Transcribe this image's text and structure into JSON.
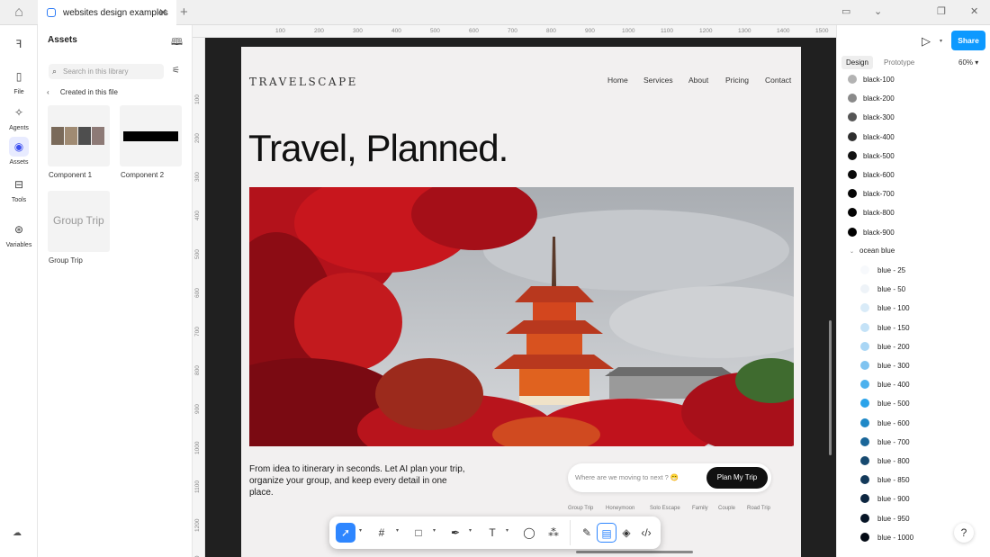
{
  "titlebar": {
    "tab_title": "websites design examples",
    "new_tab": "+"
  },
  "rail": {
    "items": [
      {
        "label": "File",
        "icon": "file-icon"
      },
      {
        "label": "Agents",
        "icon": "agents-icon"
      },
      {
        "label": "Assets",
        "icon": "assets-icon"
      },
      {
        "label": "Tools",
        "icon": "tools-icon"
      },
      {
        "label": "Variables",
        "icon": "variables-icon"
      }
    ]
  },
  "assets": {
    "title": "Assets",
    "search_placeholder": "Search in this library",
    "section": "Created in this file",
    "components": [
      {
        "label": "Component 1"
      },
      {
        "label": "Component 2"
      },
      {
        "label": "Group Trip",
        "preview": "Group Trip"
      }
    ]
  },
  "rulers": {
    "top": [
      "100",
      "200",
      "300",
      "400",
      "500",
      "600",
      "700",
      "800",
      "900",
      "1000",
      "1100",
      "1200",
      "1300",
      "1400",
      "1500"
    ],
    "left": [
      "100",
      "200",
      "300",
      "400",
      "500",
      "600",
      "700",
      "800",
      "900",
      "1000",
      "1100",
      "1200",
      "1300"
    ]
  },
  "site": {
    "logo": "TRAVELSCAPE",
    "nav": [
      "Home",
      "Services",
      "About",
      "Pricing",
      "Contact"
    ],
    "hero_title": "Travel, Planned.",
    "tagline": "From idea to itinerary in seconds. Let AI plan your trip, organize your group, and keep every detail in one place.",
    "input_placeholder": "Where are we moving to next ? 😁",
    "cta": "Plan My Trip",
    "chips": [
      "Group Trip",
      "Honeymoon",
      "Solo Escape",
      "Family",
      "Couple",
      "Road Trip"
    ]
  },
  "right": {
    "share": "Share",
    "tabs": [
      "Design",
      "Prototype"
    ],
    "zoom": "60%",
    "black_swatches": [
      {
        "name": "black-100",
        "color": "#b3b3b3"
      },
      {
        "name": "black-200",
        "color": "#8a8a8a"
      },
      {
        "name": "black-300",
        "color": "#555555"
      },
      {
        "name": "black-400",
        "color": "#2e2e2e"
      },
      {
        "name": "black-500",
        "color": "#111111"
      },
      {
        "name": "black-600",
        "color": "#0a0a0a"
      },
      {
        "name": "black-700",
        "color": "#060606"
      },
      {
        "name": "black-800",
        "color": "#030303"
      },
      {
        "name": "black-900",
        "color": "#000000"
      }
    ],
    "group": "ocean blue",
    "blue_swatches": [
      {
        "name": "blue - 25",
        "color": "#f7f9fc"
      },
      {
        "name": "blue - 50",
        "color": "#eef3f8"
      },
      {
        "name": "blue - 100",
        "color": "#d9ebf8"
      },
      {
        "name": "blue - 150",
        "color": "#c4e2f7"
      },
      {
        "name": "blue - 200",
        "color": "#a9d6f5"
      },
      {
        "name": "blue - 300",
        "color": "#7fc3f0"
      },
      {
        "name": "blue - 400",
        "color": "#4cb1ee"
      },
      {
        "name": "blue - 500",
        "color": "#2aa3ea"
      },
      {
        "name": "blue - 600",
        "color": "#1e88c7"
      },
      {
        "name": "blue - 700",
        "color": "#1a6699"
      },
      {
        "name": "blue - 800",
        "color": "#174a70"
      },
      {
        "name": "blue - 850",
        "color": "#13395a"
      },
      {
        "name": "blue - 900",
        "color": "#0d2640"
      },
      {
        "name": "blue - 950",
        "color": "#071526"
      },
      {
        "name": "blue - 1000",
        "color": "#030a14"
      }
    ],
    "help": "?"
  }
}
